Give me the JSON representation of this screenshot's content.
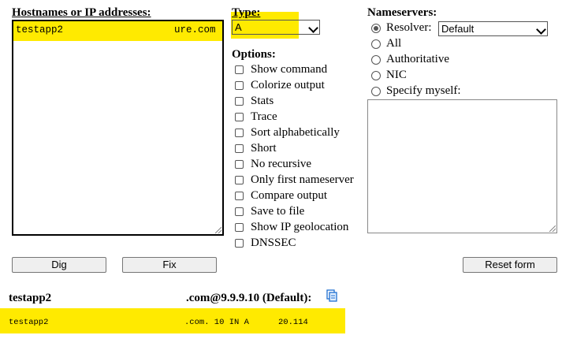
{
  "hostnames": {
    "title_prefix": "H",
    "title_rest": "ostnames or IP addresses:",
    "line_left": "testapp2",
    "line_right": "ure.com"
  },
  "type": {
    "title": "Type:",
    "value": "A"
  },
  "options": {
    "title": "Options:",
    "items": [
      {
        "label": "Show command",
        "checked": false
      },
      {
        "label": "Colorize output",
        "checked": false
      },
      {
        "label": "Stats",
        "checked": false
      },
      {
        "label": "Trace",
        "checked": false
      },
      {
        "label": "Sort alphabetically",
        "checked": false
      },
      {
        "label": "Short",
        "checked": false
      },
      {
        "label": "No recursive",
        "checked": false
      },
      {
        "label": "Only first nameserver",
        "checked": false
      },
      {
        "label": "Compare output",
        "checked": false
      },
      {
        "label": "Save to file",
        "checked": false
      },
      {
        "label": "Show IP geolocation",
        "checked": false
      },
      {
        "label": "DNSSEC",
        "checked": false
      }
    ]
  },
  "nameservers": {
    "title": "Nameservers:",
    "options": [
      {
        "label": "Resolver:",
        "selected": true
      },
      {
        "label": "All",
        "selected": false
      },
      {
        "label": "Authoritative",
        "selected": false
      },
      {
        "label": "NIC",
        "selected": false
      },
      {
        "label": "Specify myself:",
        "selected": false
      }
    ],
    "resolver_value": "Default"
  },
  "buttons": {
    "dig": "Dig",
    "fix": "Fix",
    "reset": "Reset form"
  },
  "result": {
    "host": "testapp2",
    "server": ".com@9.9.9.10 (Default):",
    "answer_host": "testapp2",
    "answer_rest": ".com. 10 IN A",
    "answer_ip": "20.114"
  },
  "colors": {
    "highlight": "#ffea00"
  }
}
